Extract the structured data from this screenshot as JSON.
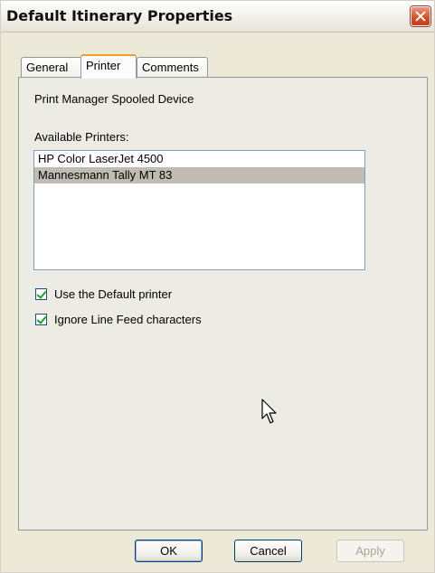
{
  "window": {
    "title": "Default Itinerary Properties"
  },
  "tabs": [
    {
      "label": "General",
      "active": false
    },
    {
      "label": "Printer",
      "active": true
    },
    {
      "label": "Comments",
      "active": false
    }
  ],
  "printer_tab": {
    "device_label": "Print Manager Spooled Device",
    "available_label": "Available Printers:",
    "printers": [
      {
        "name": "HP Color LaserJet 4500",
        "selected": false
      },
      {
        "name": "Mannesmann Tally MT 83",
        "selected": true
      }
    ],
    "options": [
      {
        "label": "Use the Default printer",
        "checked": true
      },
      {
        "label": "Ignore Line Feed characters",
        "checked": true
      }
    ]
  },
  "buttons": {
    "ok": "OK",
    "cancel": "Cancel",
    "apply": "Apply"
  },
  "icons": {
    "close": "close-icon",
    "cursor": "mouse-pointer-icon"
  }
}
